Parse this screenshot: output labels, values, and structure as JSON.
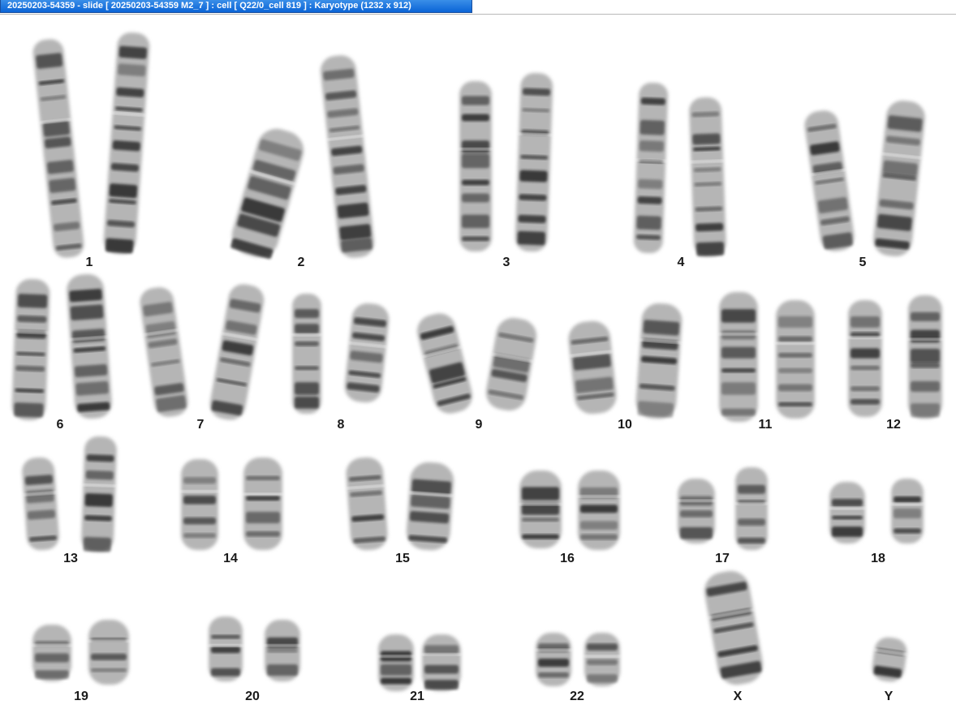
{
  "window": {
    "title": "20250203-54359 - slide [ 20250203-54359 M2_7 ] : cell [ Q22/0_cell 819 ] : Karyotype  (1232 x 912)"
  },
  "colors": {
    "titlebar_accent": "#0a64d6",
    "background": "#ffffff",
    "chromosome_dark": "#222222",
    "chromosome_light": "#b5b5b5"
  },
  "karyotype": {
    "chromosomes": [
      {
        "label": "1",
        "count": 2
      },
      {
        "label": "2",
        "count": 2
      },
      {
        "label": "3",
        "count": 2
      },
      {
        "label": "4",
        "count": 2
      },
      {
        "label": "5",
        "count": 2
      },
      {
        "label": "6",
        "count": 2
      },
      {
        "label": "7",
        "count": 2
      },
      {
        "label": "8",
        "count": 2
      },
      {
        "label": "9",
        "count": 2
      },
      {
        "label": "10",
        "count": 2
      },
      {
        "label": "11",
        "count": 2
      },
      {
        "label": "12",
        "count": 2
      },
      {
        "label": "13",
        "count": 2
      },
      {
        "label": "14",
        "count": 2
      },
      {
        "label": "15",
        "count": 2
      },
      {
        "label": "16",
        "count": 2
      },
      {
        "label": "17",
        "count": 2
      },
      {
        "label": "18",
        "count": 2
      },
      {
        "label": "19",
        "count": 2
      },
      {
        "label": "20",
        "count": 2
      },
      {
        "label": "21",
        "count": 2
      },
      {
        "label": "22",
        "count": 2
      },
      {
        "label": "X",
        "count": 1
      },
      {
        "label": "Y",
        "count": 1
      }
    ]
  }
}
